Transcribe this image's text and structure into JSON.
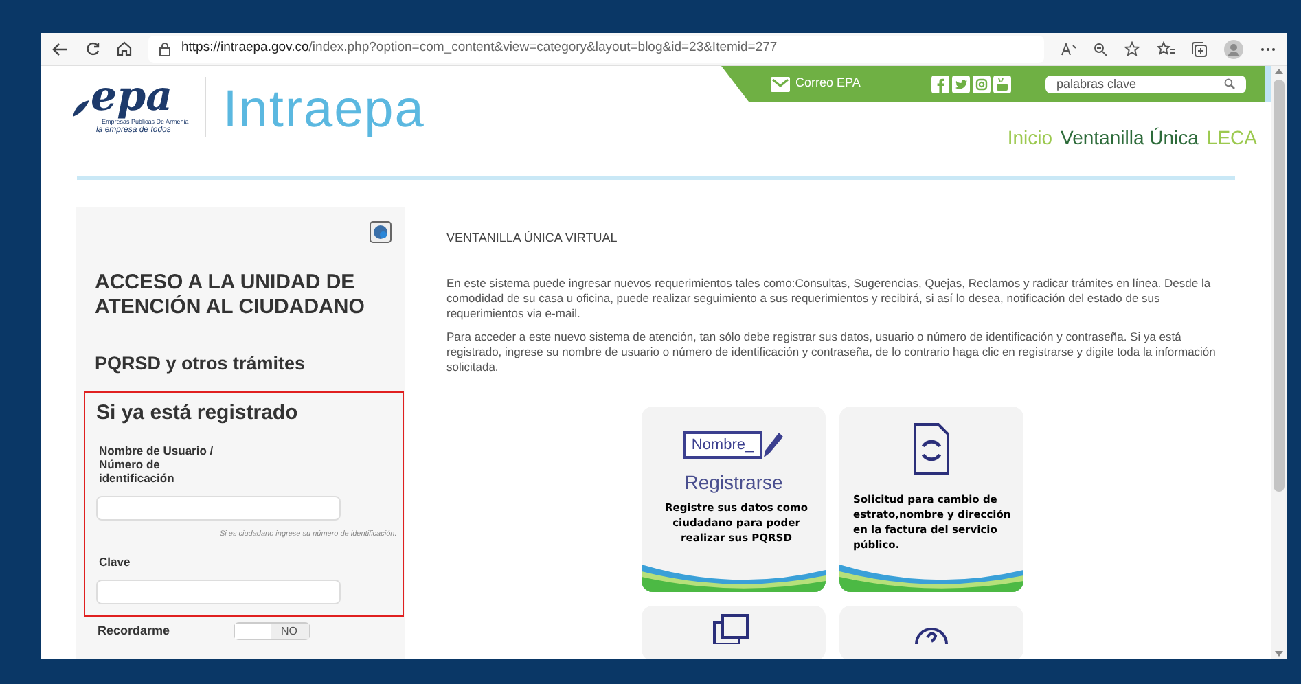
{
  "browser": {
    "url_host": "https://intraepa.gov.co",
    "url_path": "/index.php?option=com_content&view=category&layout=blog&id=23&Itemid=277"
  },
  "header": {
    "logo_mark": "epa",
    "logo_company": "Empresas Públicas De Armenia",
    "logo_tagline": "la empresa de todos",
    "site_name": "Intraepa",
    "mail_link": "Correo EPA",
    "search": {
      "placeholder": "palabras clave"
    },
    "nav": [
      {
        "label": "Inicio",
        "selected": false
      },
      {
        "label": "Ventanilla Única",
        "selected": true
      },
      {
        "label": "LECA",
        "selected": false
      }
    ]
  },
  "sidebar": {
    "title": "ACCESO A LA UNIDAD DE ATENCIÓN AL CIUDADANO",
    "subtitle": "PQRSD y otros trámites",
    "form": {
      "heading": "Si ya está registrado",
      "fields": [
        {
          "label": "Nombre de Usuario / Número de identificación",
          "hint": "Si es ciudadano ingrese su número de identificación."
        },
        {
          "label": "Clave"
        }
      ]
    },
    "remember": {
      "label": "Recordarme",
      "toggle_text": "NO",
      "on": false
    }
  },
  "main": {
    "section_title": "VENTANILLA ÚNICA VIRTUAL",
    "paragraphs": [
      "En este sistema puede ingresar nuevos requerimientos tales como:Consultas, Sugerencias, Quejas, Reclamos y radicar trámites en línea. Desde la comodidad de su casa u oficina, puede realizar seguimiento a sus requerimientos y recibirá, si así lo desea, notificación del estado de sus requerimientos via e-mail.",
      "Para acceder a este nuevo sistema de atención, tan sólo debe registrar sus datos, usuario o número de identificación y contraseña. Si ya está registrado, ingrese su nombre de usuario o número de identificación y contraseña, de lo contrario haga clic en registrarse y digite toda la información solicitada."
    ],
    "cards": [
      {
        "kind": "register",
        "icon_text": "Nombre_",
        "title": "Registrarse",
        "text": "Registre sus datos como ciudadano para poder realizar sus PQRSD"
      },
      {
        "kind": "document",
        "text": "Solicitud para cambio de estrato,nombre y dirección en la factura del servicio público."
      },
      {
        "kind": "copies"
      },
      {
        "kind": "help"
      }
    ]
  }
}
